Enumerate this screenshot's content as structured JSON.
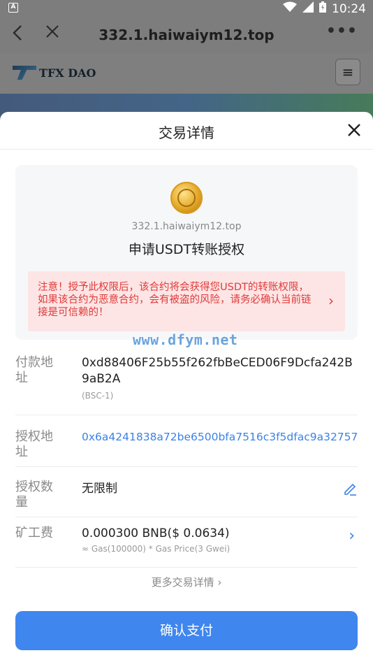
{
  "status_bar": {
    "left_icon": "A",
    "time": "10:24",
    "icons": [
      "wifi-icon",
      "signal-icon",
      "battery-icon"
    ]
  },
  "browser": {
    "back_icon": "‹",
    "close_icon": "✕",
    "title": "332.1.haiwaiym12.top",
    "more_icon": "•••"
  },
  "webpage": {
    "logo_text": "TFX DAO",
    "menu_icon": "≡"
  },
  "sheet": {
    "title": "交易详情",
    "close_icon": "✕",
    "site": "332.1.haiwaiym12.top",
    "request_title": "申请USDT转账授权",
    "warning": "注意！授予此权限后，该合约将会获得您USDT的转账权限，如果该合约为恶意合约，会有被盗的风险，请务必确认当前链接是可信赖的！",
    "warning_chevron": "›",
    "watermark": "www.dfym.net",
    "rows": {
      "payer": {
        "label": "付款地址",
        "value": "0xd88406F25b55f262fbBeCED06F9Dcfa242B9aB2A",
        "sub": "(BSC-1)"
      },
      "spender": {
        "label": "授权地址",
        "value": "0x6a4241838a72be6500bfa7516c3f5dfac9a32757"
      },
      "amount": {
        "label": "授权数量",
        "value": "无限制",
        "edit_icon": "✎"
      },
      "fee": {
        "label": "矿工费",
        "value": "0.000300 BNB($ 0.0634)",
        "sub": "≈ Gas(100000) * Gas Price(3 Gwei)",
        "chevron": "›"
      }
    },
    "more_details": "更多交易详情 ›",
    "confirm_button": "确认支付"
  },
  "colors": {
    "accent": "#3f86ef",
    "warning_bg": "#fde5e5",
    "warning_text": "#e03a3a",
    "link": "#3b82e6"
  }
}
